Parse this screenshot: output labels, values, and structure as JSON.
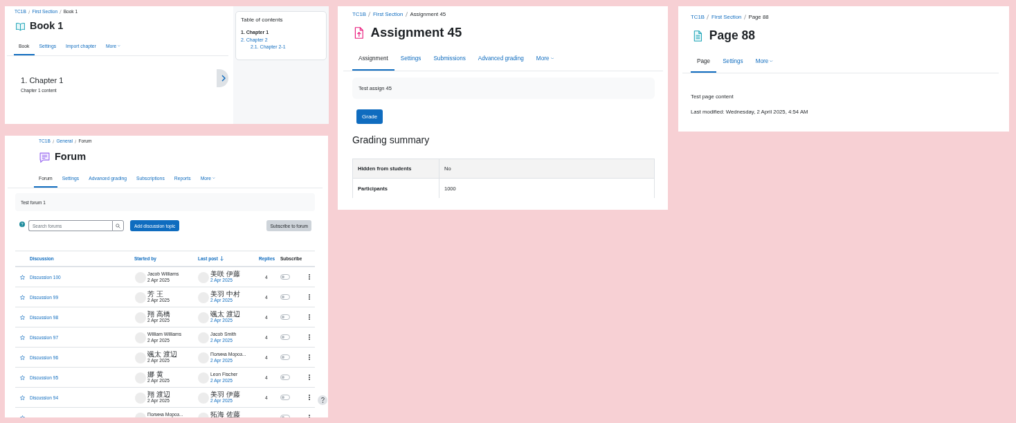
{
  "book": {
    "breadcrumb": [
      {
        "label": "TC1B",
        "current": false
      },
      {
        "label": "First Section",
        "current": false
      },
      {
        "label": "Book 1",
        "current": true
      }
    ],
    "title": "Book 1",
    "tabs": [
      {
        "label": "Book",
        "kind": "link",
        "selected": true
      },
      {
        "label": "Settings",
        "kind": "link",
        "selected": false
      },
      {
        "label": "Import chapter",
        "kind": "link",
        "selected": false
      },
      {
        "label": "More",
        "kind": "menu",
        "selected": false
      }
    ],
    "chapter": {
      "heading": "1. Chapter 1",
      "content": "Chapter 1 content"
    },
    "toc": {
      "title": "Table of contents",
      "items": [
        {
          "label": "1. Chapter 1",
          "selected": true
        },
        {
          "label": "2. Chapter 2",
          "selected": false,
          "children": [
            {
              "label": "2.1. Chapter 2-1",
              "selected": false
            }
          ]
        }
      ]
    }
  },
  "forum": {
    "breadcrumb": [
      {
        "label": "TC1B",
        "current": false
      },
      {
        "label": "General",
        "current": false
      },
      {
        "label": "Forum",
        "current": true
      }
    ],
    "title": "Forum",
    "tabs": [
      {
        "label": "Forum",
        "kind": "link",
        "selected": true
      },
      {
        "label": "Settings",
        "kind": "link",
        "selected": false
      },
      {
        "label": "Advanced grading",
        "kind": "link",
        "selected": false
      },
      {
        "label": "Subscriptions",
        "kind": "link",
        "selected": false
      },
      {
        "label": "Reports",
        "kind": "link",
        "selected": false
      },
      {
        "label": "More",
        "kind": "menu",
        "selected": false
      }
    ],
    "intro": "Test forum 1",
    "search": {
      "placeholder": "Search forums"
    },
    "add_button": "Add discussion topic",
    "subscribe_button": "Subscribe to forum",
    "table": {
      "columns": [
        {
          "label": "Discussion",
          "sortable": true,
          "sorted": false
        },
        {
          "label": "Started by",
          "sortable": true,
          "sorted": false
        },
        {
          "label": "Last post",
          "sortable": true,
          "sorted": true
        },
        {
          "label": "Replies",
          "sortable": true,
          "sorted": false
        },
        {
          "label": "Subscribe",
          "sortable": false,
          "sorted": false
        }
      ],
      "rows": [
        {
          "discussion": "Discussion 100",
          "starred": false,
          "started_by": {
            "name": "Jacob Williams",
            "date": "2 Apr 2025"
          },
          "last_post": {
            "name": "美咲 伊藤",
            "date": "2 Apr 2025"
          },
          "replies": "4",
          "subscribed": false
        },
        {
          "discussion": "Discussion 99",
          "starred": false,
          "started_by": {
            "name": "芳 王",
            "date": "2 Apr 2025"
          },
          "last_post": {
            "name": "美羽 中村",
            "date": "2 Apr 2025"
          },
          "replies": "4",
          "subscribed": false
        },
        {
          "discussion": "Discussion 98",
          "starred": false,
          "started_by": {
            "name": "翔 高橋",
            "date": "2 Apr 2025"
          },
          "last_post": {
            "name": "颯太 渡辺",
            "date": "2 Apr 2025"
          },
          "replies": "4",
          "subscribed": false
        },
        {
          "discussion": "Discussion 97",
          "starred": false,
          "started_by": {
            "name": "William Williams",
            "date": "2 Apr 2025"
          },
          "last_post": {
            "name": "Jacob Smith",
            "date": "2 Apr 2025"
          },
          "replies": "4",
          "subscribed": false
        },
        {
          "discussion": "Discussion 96",
          "starred": false,
          "started_by": {
            "name": "颯太 渡辺",
            "date": "2 Apr 2025"
          },
          "last_post": {
            "name": "Полина Мороз...",
            "date": "2 Apr 2025"
          },
          "replies": "4",
          "subscribed": false
        },
        {
          "discussion": "Discussion 95",
          "starred": false,
          "started_by": {
            "name": "娜 黄",
            "date": "2 Apr 2025"
          },
          "last_post": {
            "name": "Leon Fischer",
            "date": "2 Apr 2025"
          },
          "replies": "4",
          "subscribed": false
        },
        {
          "discussion": "Discussion 94",
          "starred": false,
          "started_by": {
            "name": "翔 渡辺",
            "date": "2 Apr 2025"
          },
          "last_post": {
            "name": "美羽 伊藤",
            "date": "2 Apr 2025"
          },
          "replies": "4",
          "subscribed": false
        },
        {
          "starred": false,
          "started_by": {
            "name": "Полина Мороз..."
          },
          "last_post": {
            "name": "拓海 佐藤"
          },
          "subscribed": false
        }
      ]
    }
  },
  "assignment": {
    "breadcrumb": [
      {
        "label": "TC1B",
        "current": false
      },
      {
        "label": "First Section",
        "current": false
      },
      {
        "label": "Assignment 45",
        "current": true
      }
    ],
    "title": "Assignment 45",
    "tabs": [
      {
        "label": "Assignment",
        "kind": "link",
        "selected": true
      },
      {
        "label": "Settings",
        "kind": "link",
        "selected": false
      },
      {
        "label": "Submissions",
        "kind": "link",
        "selected": false
      },
      {
        "label": "Advanced grading",
        "kind": "link",
        "selected": false
      },
      {
        "label": "More",
        "kind": "menu",
        "selected": false
      }
    ],
    "intro": "Test assign 45",
    "grade_button": "Grade",
    "summary": {
      "heading": "Grading summary",
      "rows": [
        {
          "label": "Hidden from students",
          "value": "No"
        },
        {
          "label": "Participants",
          "value": "1000"
        }
      ]
    }
  },
  "page": {
    "breadcrumb": [
      {
        "label": "TC1B",
        "current": false
      },
      {
        "label": "First Section",
        "current": false
      },
      {
        "label": "Page 88",
        "current": true
      }
    ],
    "title": "Page 88",
    "tabs": [
      {
        "label": "Page",
        "kind": "link",
        "selected": true
      },
      {
        "label": "Settings",
        "kind": "link",
        "selected": false
      },
      {
        "label": "More",
        "kind": "menu",
        "selected": false
      }
    ],
    "content": "Test page content",
    "last_modified": "Last modified: Wednesday, 2 April 2025, 4:54 AM"
  }
}
